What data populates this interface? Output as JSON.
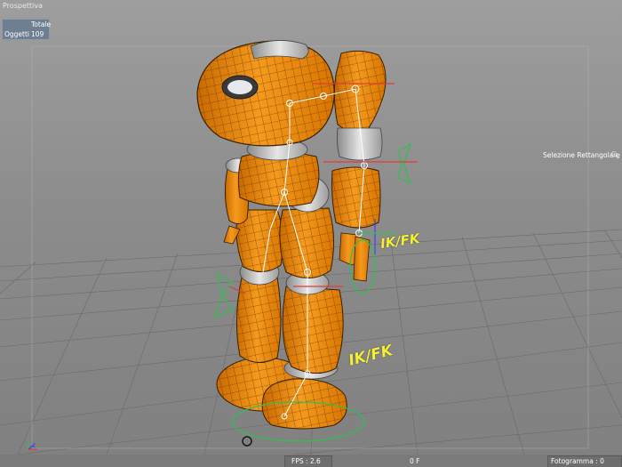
{
  "viewport": {
    "title": "Prospettiva",
    "stats": {
      "header": "Totale",
      "objects_label": "Oggetti",
      "objects_value": "109"
    },
    "selection_mode": "Selezione Rettangolare",
    "selection_icon": "magnifier-icon"
  },
  "scene": {
    "ik_fk_arm": "IK/FK",
    "ik_fk_leg": "IK/FK",
    "axis_z": "z",
    "robot_color": "#f08a0c",
    "joint_color": "#d9d9d9",
    "controller_color": "#2cc24e",
    "bone_color": "#ffffff",
    "ikfk_label_color": "#f4ef3a"
  },
  "status_bar": {
    "fps": "FPS : 2.6",
    "frame": "0 F",
    "frames": "Fotogramma : 0"
  }
}
